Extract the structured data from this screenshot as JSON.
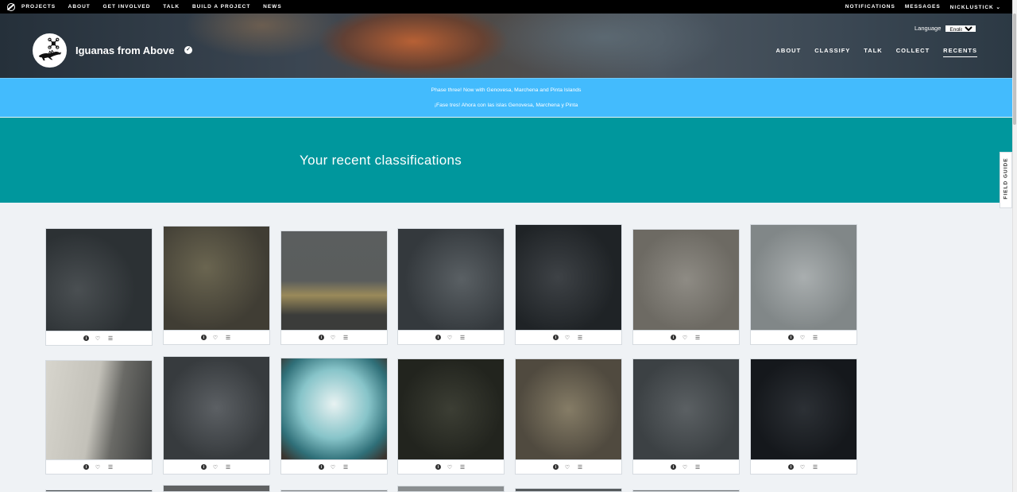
{
  "topnav": {
    "left": [
      "PROJECTS",
      "ABOUT",
      "GET INVOLVED",
      "TALK",
      "BUILD A PROJECT",
      "NEWS"
    ],
    "right": [
      "NOTIFICATIONS",
      "MESSAGES",
      "NICKLUSTICK"
    ]
  },
  "project": {
    "title": "Iguanas from Above",
    "language_label": "Language",
    "language_value": "English",
    "nav": [
      "ABOUT",
      "CLASSIFY",
      "TALK",
      "COLLECT",
      "RECENTS"
    ],
    "active_nav": "RECENTS"
  },
  "announcement": {
    "line1": "Phase three! Now with Genovesa, Marchena and Pinta Islands",
    "line2": "¡Fase tres! Ahora con las islas Genovesa, Marchena y Pinta"
  },
  "hero": {
    "title": "Your recent classifications"
  },
  "field_guide": "FIELD GUIDE",
  "card_icons": [
    "info-icon",
    "heart-icon",
    "collect-list-icon"
  ]
}
